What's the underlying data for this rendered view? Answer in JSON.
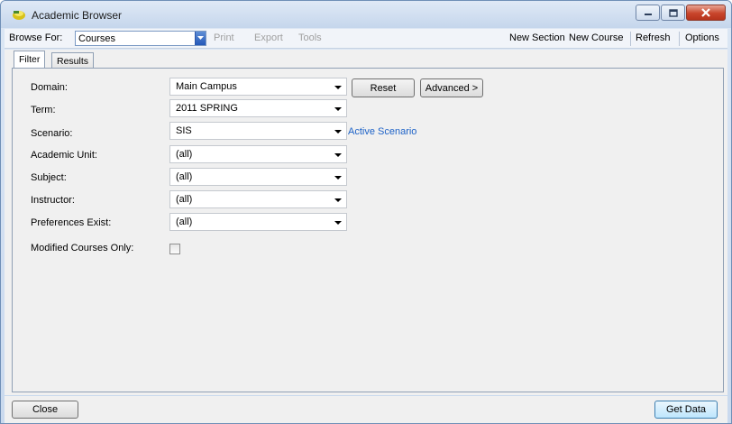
{
  "window": {
    "title": "Academic Browser",
    "controls": [
      "minimize-icon",
      "maximize-icon",
      "close-icon"
    ]
  },
  "menubar": {
    "browse_label": "Browse For:",
    "browse_value": "Courses",
    "print": "Print",
    "export": "Export",
    "tools": "Tools",
    "new_section": "New Section",
    "new_course": "New Course",
    "refresh": "Refresh",
    "options": "Options"
  },
  "tabs": [
    {
      "label": "Filter",
      "active": true
    },
    {
      "label": "Results",
      "active": false
    }
  ],
  "filter": {
    "domain": {
      "label": "Domain:",
      "value": "Main Campus"
    },
    "term": {
      "label": "Term:",
      "value": "2011 SPRING"
    },
    "scenario": {
      "label": "Scenario:",
      "value": "SIS"
    },
    "academic_unit": {
      "label": "Academic Unit:",
      "value": "(all)"
    },
    "subject": {
      "label": "Subject:",
      "value": "(all)"
    },
    "instructor": {
      "label": "Instructor:",
      "value": "(all)"
    },
    "preferences": {
      "label": "Preferences Exist:",
      "value": "(all)"
    },
    "modified": {
      "label": "Modified Courses Only:",
      "checked": false
    },
    "reset": "Reset",
    "advanced": "Advanced >",
    "active_scenario": "Active Scenario"
  },
  "footer": {
    "close": "Close",
    "get_data": "Get Data"
  }
}
